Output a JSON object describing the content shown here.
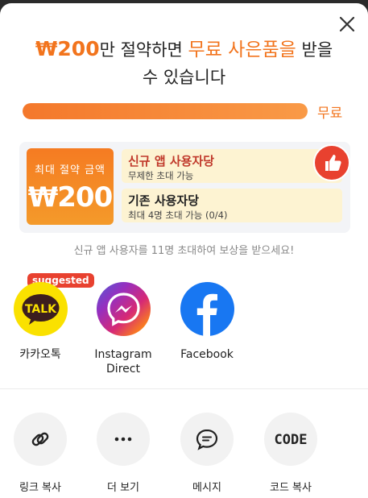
{
  "headline": {
    "amount": "₩200",
    "part1": "만 절약하면 ",
    "highlight": "무료 사은품을",
    "part2": " 받을",
    "line2": "수 있습니다"
  },
  "progress": {
    "value_percent": 100,
    "label": "무료"
  },
  "promo": {
    "save_label": "최대 절약 금액",
    "save_amount": "₩200",
    "new_user": {
      "title": "신규 앱 사용자당",
      "desc": "무제한 초대 가능"
    },
    "existing_user": {
      "title": "기존 사용자당",
      "desc": "최대 4명 초대 가능 (0/4)"
    }
  },
  "invite_note": "신규 앱 사용자를 11명 초대하여 보상을 받으세요!",
  "apps": [
    {
      "name": "카카오톡",
      "icon": "kakaotalk-icon",
      "badge": "suggested"
    },
    {
      "name": "Instagram\nDirect",
      "icon": "messenger-icon"
    },
    {
      "name": "Facebook",
      "icon": "facebook-icon"
    }
  ],
  "tools": [
    {
      "name": "링크 복사",
      "icon": "link-icon"
    },
    {
      "name": "더 보기",
      "icon": "more-icon"
    },
    {
      "name": "메시지",
      "icon": "message-icon"
    },
    {
      "name": "코드 복사",
      "icon": "code-icon"
    }
  ],
  "colors": {
    "accent": "#f2741d",
    "badge": "#e8412f",
    "facebook": "#1877f2",
    "kakao": "#fae100"
  }
}
